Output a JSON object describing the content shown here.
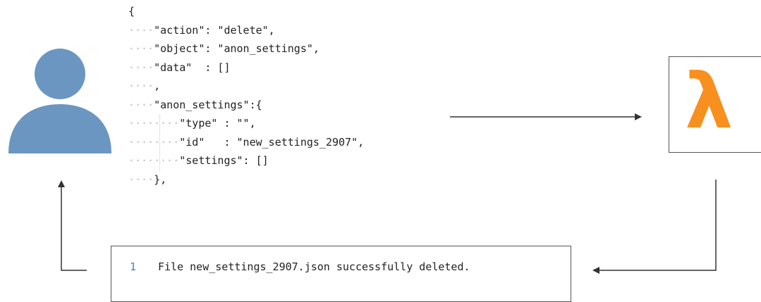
{
  "request_payload": {
    "lines": [
      {
        "indent": 0,
        "text": "{"
      },
      {
        "indent": 1,
        "text": "\"action\": \"delete\","
      },
      {
        "indent": 1,
        "text": "\"object\": \"anon_settings\","
      },
      {
        "indent": 1,
        "text": "\"data\"  : []"
      },
      {
        "indent": 1,
        "text": ","
      },
      {
        "indent": 1,
        "text": "\"anon_settings\":{"
      },
      {
        "indent": 2,
        "text": "\"type\" : \"\","
      },
      {
        "indent": 2,
        "text": "\"id\"   : \"new_settings_2907\","
      },
      {
        "indent": 2,
        "text": "\"settings\": []"
      },
      {
        "indent": 1,
        "text": "},"
      }
    ]
  },
  "lambda": {
    "glyph": "λ",
    "color": "#F7901E"
  },
  "user": {
    "icon": "user-icon",
    "color": "#6b96c1"
  },
  "response": {
    "line_number": "1",
    "message": "File new_settings_2907.json successfully deleted."
  }
}
